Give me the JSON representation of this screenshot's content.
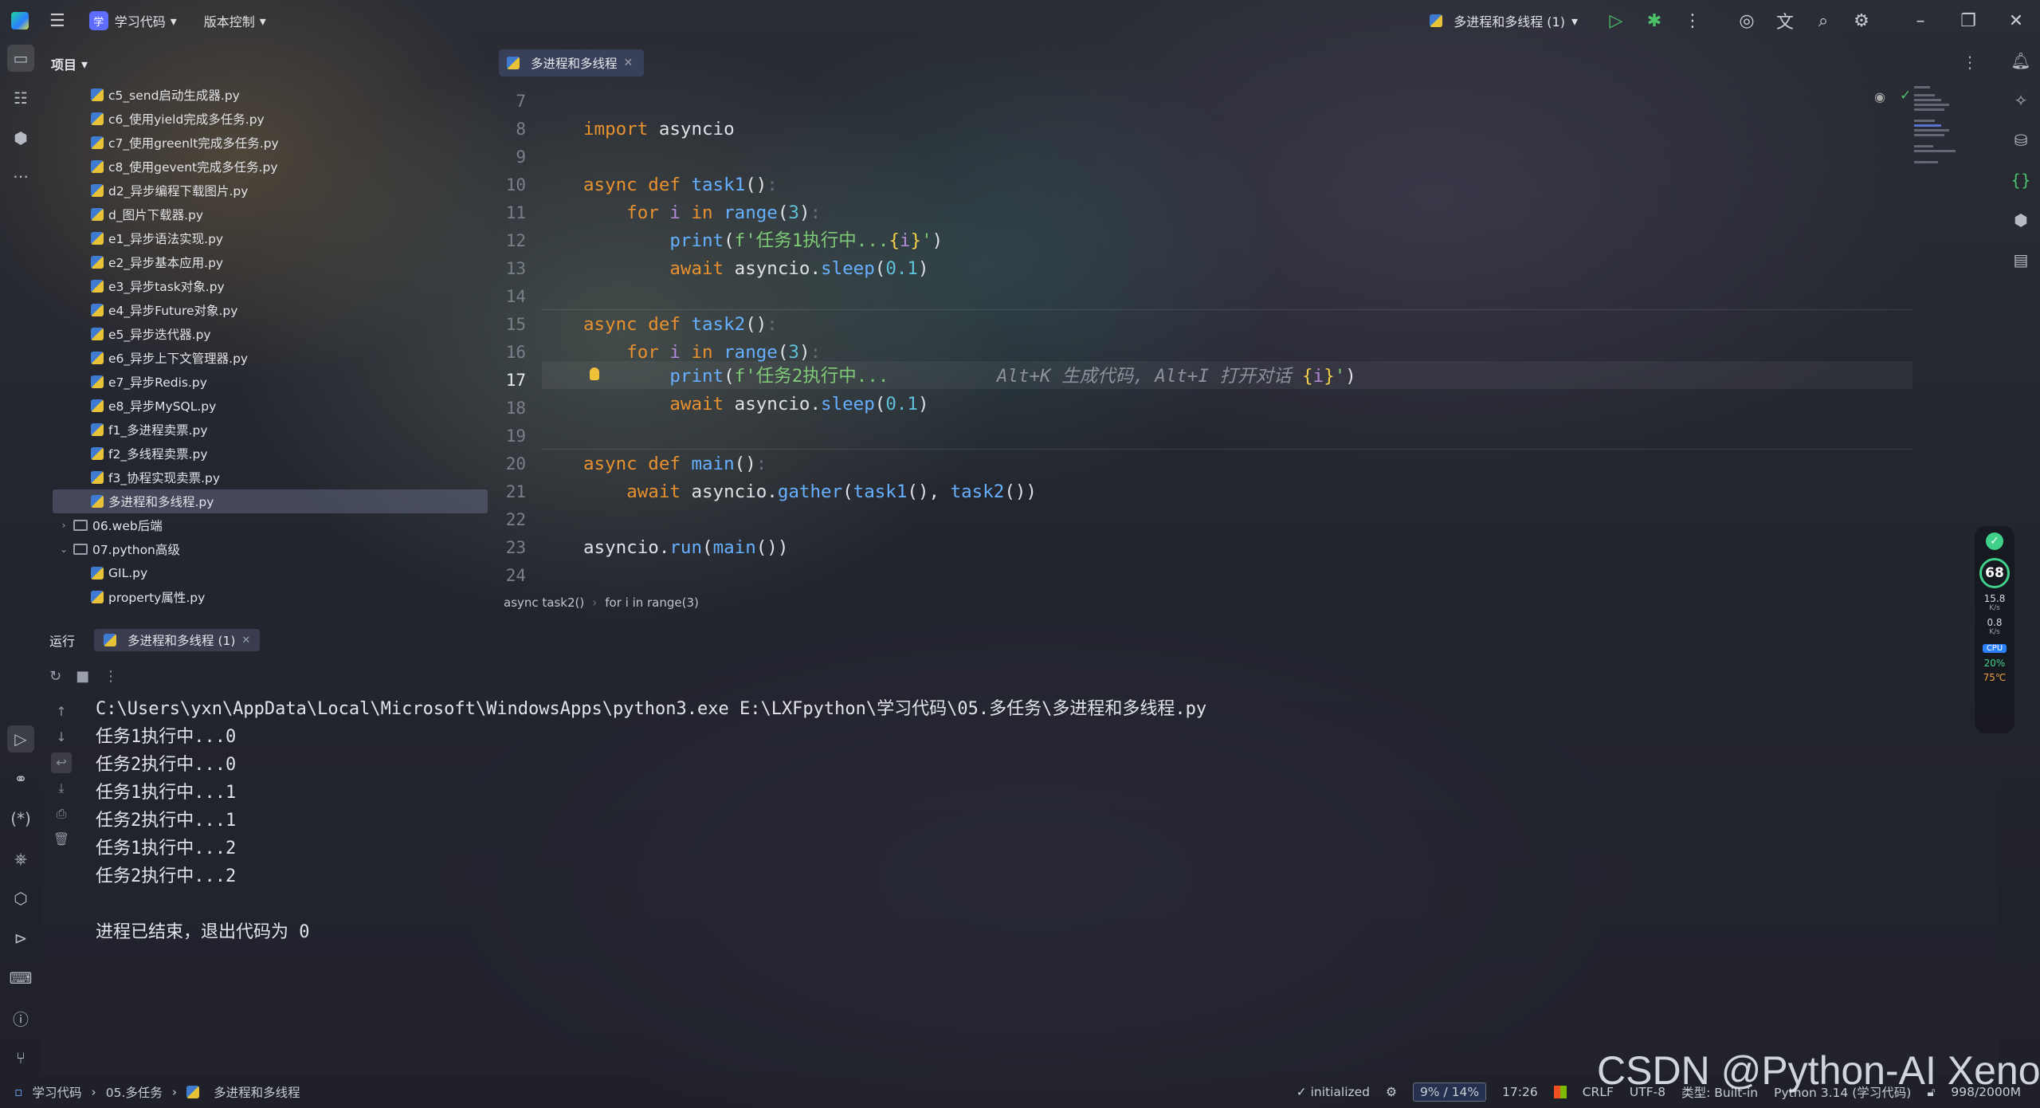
{
  "titlebar": {
    "project_badge": "学",
    "project_name": "学习代码",
    "vcs_label": "版本控制",
    "run_config": "多进程和多线程 (1)"
  },
  "project_panel": {
    "title": "项目",
    "items": [
      {
        "name": "c5_send启动生成器.py",
        "type": "py"
      },
      {
        "name": "c6_使用yield完成多任务.py",
        "type": "py"
      },
      {
        "name": "c7_使用greenlt完成多任务.py",
        "type": "py"
      },
      {
        "name": "c8_使用gevent完成多任务.py",
        "type": "py"
      },
      {
        "name": "d2_异步编程下载图片.py",
        "type": "py"
      },
      {
        "name": "d_图片下载器.py",
        "type": "py"
      },
      {
        "name": "e1_异步语法实现.py",
        "type": "py"
      },
      {
        "name": "e2_异步基本应用.py",
        "type": "py"
      },
      {
        "name": "e3_异步task对象.py",
        "type": "py"
      },
      {
        "name": "e4_异步Future对象.py",
        "type": "py"
      },
      {
        "name": "e5_异步迭代器.py",
        "type": "py"
      },
      {
        "name": "e6_异步上下文管理器.py",
        "type": "py"
      },
      {
        "name": "e7_异步Redis.py",
        "type": "py"
      },
      {
        "name": "e8_异步MySQL.py",
        "type": "py"
      },
      {
        "name": "f1_多进程卖票.py",
        "type": "py"
      },
      {
        "name": "f2_多线程卖票.py",
        "type": "py"
      },
      {
        "name": "f3_协程实现卖票.py",
        "type": "py"
      },
      {
        "name": "多进程和多线程.py",
        "type": "py",
        "selected": true
      },
      {
        "name": "06.web后端",
        "type": "folder"
      },
      {
        "name": "07.python高级",
        "type": "folder-open"
      },
      {
        "name": "GIL.py",
        "type": "py"
      },
      {
        "name": "property属性.py",
        "type": "py"
      }
    ]
  },
  "editor": {
    "tab_label": "多进程和多线程",
    "line_numbers": [
      "7",
      "8",
      "9",
      "10",
      "11",
      "12",
      "13",
      "14",
      "15",
      "16",
      "17",
      "18",
      "19",
      "20",
      "21",
      "22",
      "23",
      "24"
    ],
    "current_line": "17",
    "inline_hint": "Alt+K 生成代码, Alt+I 打开对话",
    "breadcrumbs": [
      "async task2()",
      "for i in range(3)"
    ]
  },
  "run": {
    "label": "运行",
    "tab_label": "多进程和多线程 (1)",
    "output": [
      "C:\\Users\\yxn\\AppData\\Local\\Microsoft\\WindowsApps\\python3.exe E:\\LXFpython\\学习代码\\05.多任务\\多进程和多线程.py",
      "任务1执行中...0",
      "任务2执行中...0",
      "任务1执行中...1",
      "任务2执行中...1",
      "任务1执行中...2",
      "任务2执行中...2",
      "",
      "进程已结束，退出代码为 0"
    ]
  },
  "monitor": {
    "score": "68",
    "upload": "15.8",
    "upload_unit": "K/s",
    "download": "0.8",
    "download_unit": "K/s",
    "cpu_label": "CPU",
    "cpu": "20%",
    "temp": "75℃"
  },
  "statusbar": {
    "crumbs": [
      "学习代码",
      "05.多任务",
      "多进程和多线程"
    ],
    "initialized": "initialized",
    "mem_usage": "9% / 14%",
    "time": "17:26",
    "line_sep": "CRLF",
    "encoding": "UTF-8",
    "type": "类型: Built-in",
    "interpreter": "Python 3.14 (学习代码)",
    "heap": "998/2000M"
  },
  "watermark": "CSDN @Python-AI Xenon",
  "colors": {
    "keyword": "#e8912f",
    "function": "#66b0ff",
    "string": "#7fca76",
    "number": "#5fc0d8"
  }
}
